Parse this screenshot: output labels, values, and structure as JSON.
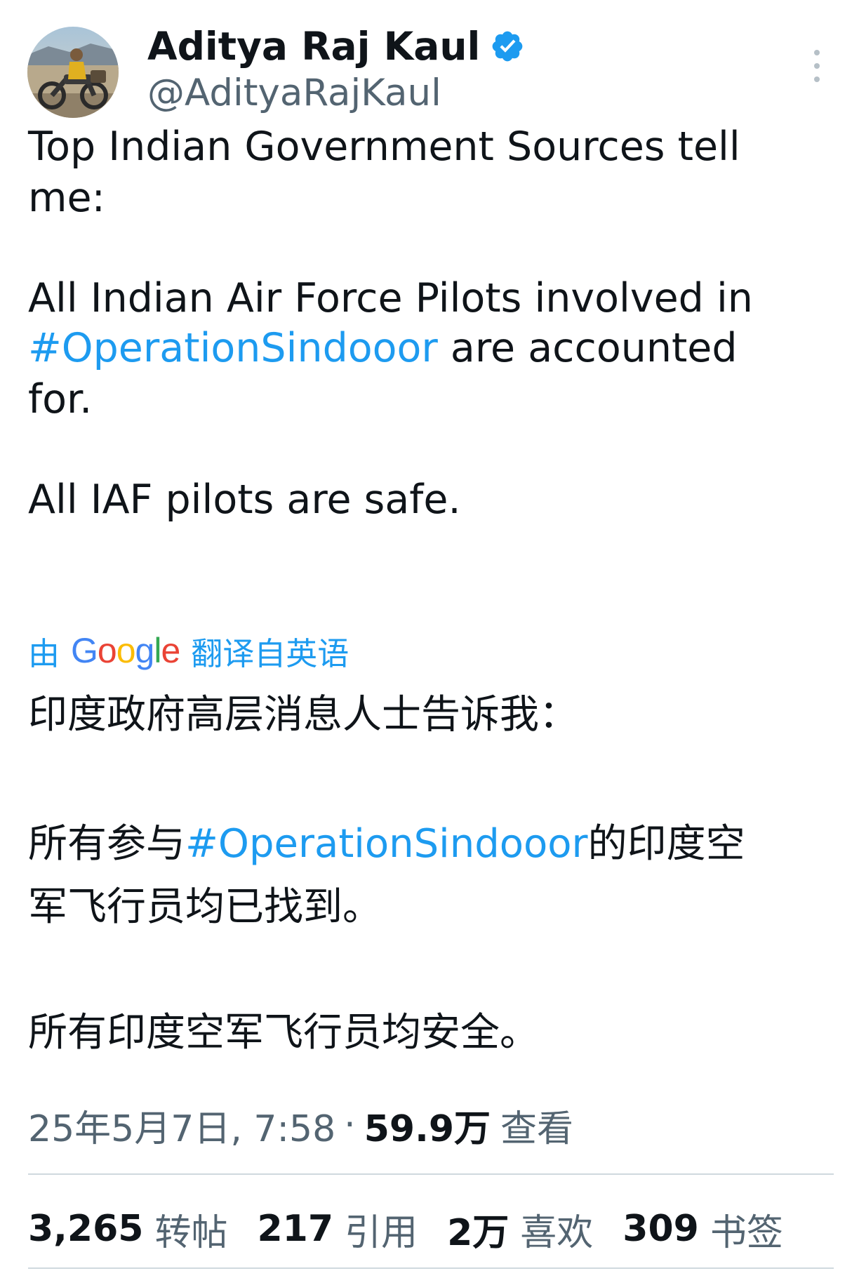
{
  "author": {
    "display_name": "Aditya Raj Kaul",
    "handle": "@AdityaRajKaul",
    "verified": true,
    "avatar_icon": "avatar-photo",
    "more_icon": "more-vertical-icon"
  },
  "tweet": {
    "line1": "Top Indian Government Sources tell",
    "line2": "me:",
    "line3": "All Indian Air Force Pilots involved in",
    "line4_hashtag": "#OperationSindooor",
    "line4_rest": " are accounted",
    "line5": "for.",
    "line6": "All IAF pilots are safe."
  },
  "translation": {
    "prefix": "由",
    "google": "Google",
    "suffix": "翻译自英语",
    "zh_line1": "印度政府高层消息人士告诉我：",
    "zh_line2_prefix": "所有参与",
    "zh_line2_hashtag": "#OperationSindooor",
    "zh_line2_suffix": "的印度空",
    "zh_line3": "军飞行员均已找到。",
    "zh_line4": "所有印度空军飞行员均安全。"
  },
  "meta": {
    "timestamp": "25年5月7日, 7:58",
    "separator": "·",
    "views_count": "59.9万",
    "views_label": "查看"
  },
  "stats": {
    "retweets_count": "3,265",
    "retweets_label": "转帖",
    "quotes_count": "217",
    "quotes_label": "引用",
    "likes_count": "2万",
    "likes_label": "喜欢",
    "bookmarks_count": "309",
    "bookmarks_label": "书签"
  },
  "colors": {
    "link": "#1d9bf0",
    "text": "#0f1419",
    "secondary": "#536471",
    "divider": "#cfd9de"
  }
}
